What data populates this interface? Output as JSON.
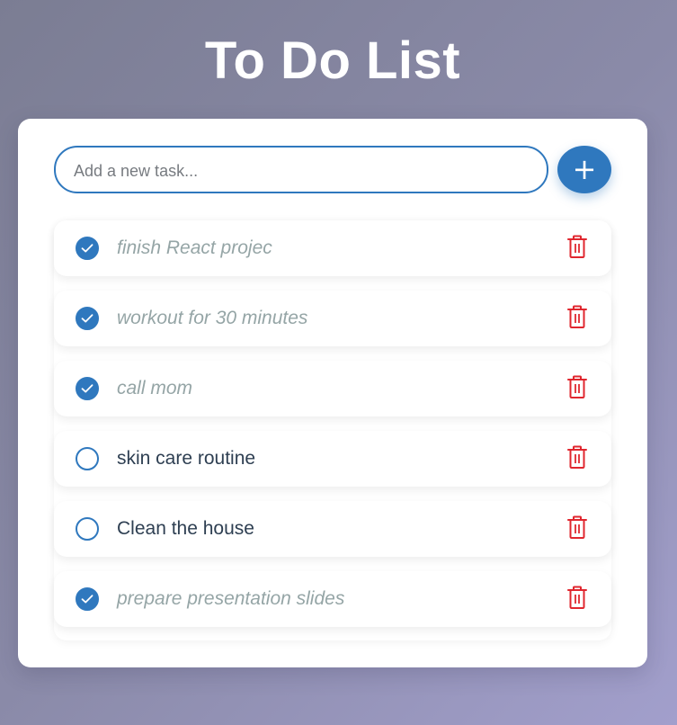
{
  "app": {
    "title": "To Do List"
  },
  "input": {
    "placeholder": "Add a new task...",
    "value": ""
  },
  "add_button": {
    "label": "+"
  },
  "tasks": [
    {
      "text": "finish React projec",
      "completed": true
    },
    {
      "text": "workout for 30 minutes",
      "completed": true
    },
    {
      "text": "call mom",
      "completed": true
    },
    {
      "text": "skin care routine",
      "completed": false
    },
    {
      "text": "Clean the house",
      "completed": false
    },
    {
      "text": "prepare presentation slides",
      "completed": true
    }
  ],
  "icons": {
    "check": "checkmark-icon",
    "delete": "trash-icon"
  },
  "colors": {
    "accent": "#2f78be",
    "delete": "#e0272f",
    "completed_text": "#95a5a6",
    "active_text": "#2e3f52"
  }
}
